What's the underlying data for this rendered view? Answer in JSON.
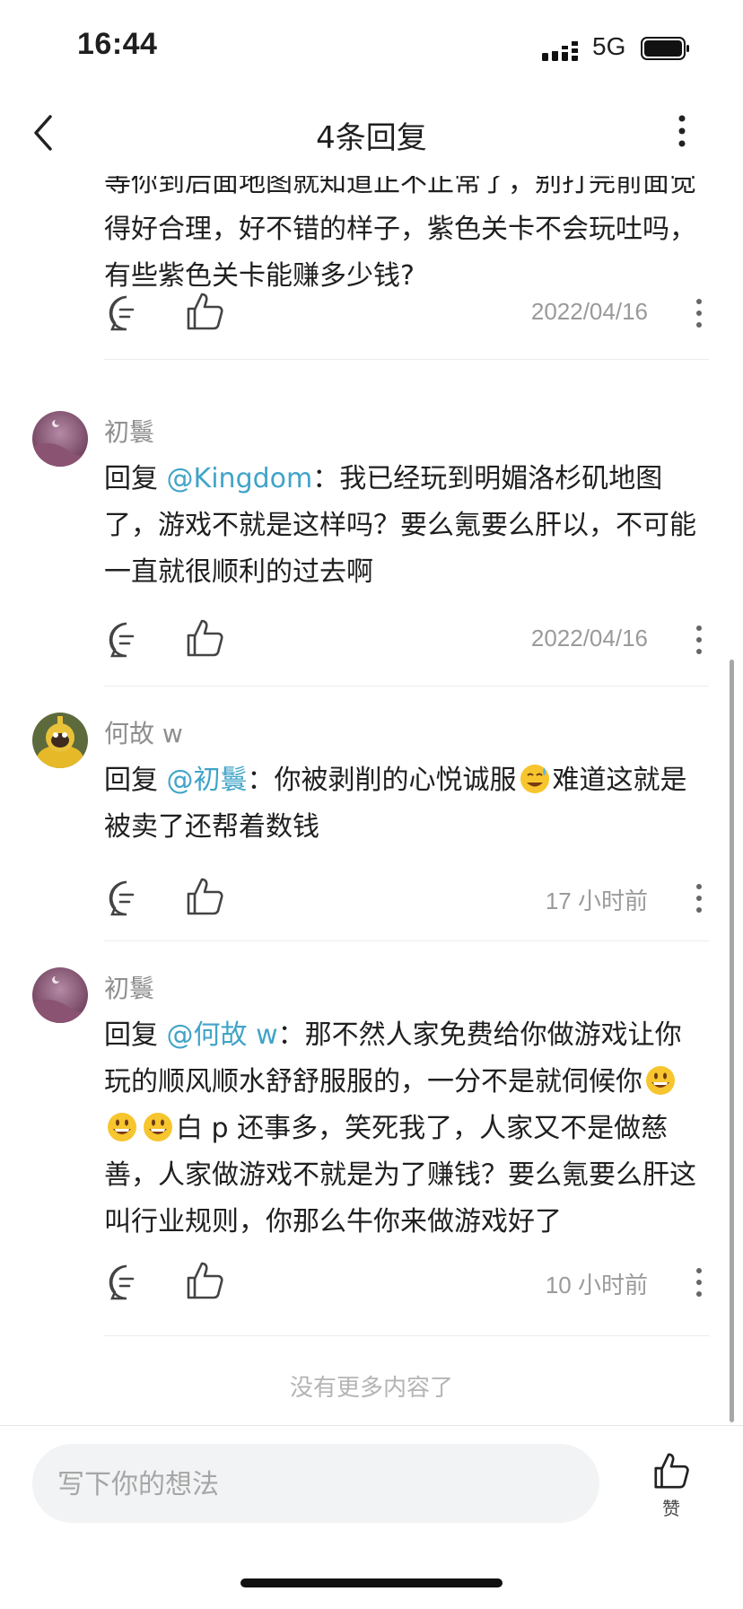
{
  "status_bar": {
    "time": "16:44",
    "network": "5G"
  },
  "nav": {
    "title": "4条回复"
  },
  "replies": [
    {
      "text": "等你到后面地图就知道正不正常了，别打完前面觉得好合理，好不错的样子，紫色关卡不会玩吐吗，有些紫色关卡能赚多少钱?",
      "timestamp": "2022/04/16"
    },
    {
      "author": "初鬟",
      "prefix": "回复 ",
      "mention": "@Kingdom",
      "text": "：我已经玩到明媚洛杉矶地图了，游戏不就是这样吗？要么氪要么肝以，不可能一直就很顺利的过去啊",
      "timestamp": "2022/04/16"
    },
    {
      "author": "何故 w",
      "prefix": "回复 ",
      "mention": "@初鬟",
      "text_a": "：你被剥削的心悦诚服",
      "text_b": "难道这就是被卖了还帮着数钱",
      "emoji": "sweat-smile",
      "timestamp": "17 小时前"
    },
    {
      "author": "初鬟",
      "prefix": "回复 ",
      "mention": "@何故 w",
      "text_a": "：那不然人家免费给你做游戏让你玩的顺风顺水舒舒服服的，一分不是就伺候你",
      "text_b": "白 p 还事多，笑死我了，人家又不是做慈善，人家做游戏不就是为了赚钱？要么氪要么肝这叫行业规则，你那么牛你来做游戏好了",
      "emoji": "grinning-face",
      "timestamp": "10 小时前"
    }
  ],
  "footer": {
    "no_more": "没有更多内容了"
  },
  "bottom_bar": {
    "placeholder": "写下你的想法",
    "like_label": "赞"
  },
  "colors": {
    "mention": "#41a4c8",
    "meta_gray": "#9a9a9a"
  }
}
